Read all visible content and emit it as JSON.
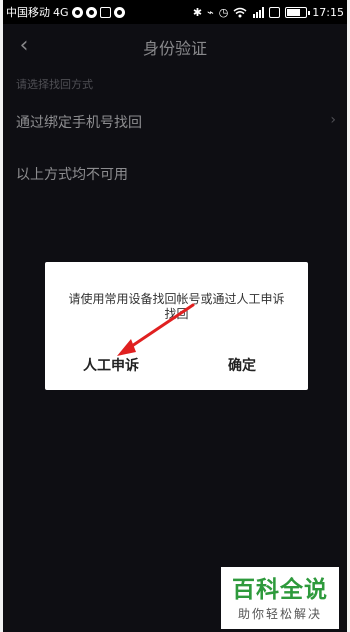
{
  "status_bar": {
    "carrier": "中国移动",
    "network": "4G",
    "time": "17:15",
    "battery_level": 0.75,
    "icons": [
      "circle-s-icon",
      "circle-s-icon",
      "image-icon",
      "cloud-icon",
      "bluetooth-icon",
      "vibrate-icon",
      "alarm-icon",
      "wifi-icon",
      "signal-icon",
      "sim-icon",
      "battery-icon"
    ]
  },
  "header": {
    "back_icon": "‹",
    "title": "身份验证"
  },
  "section_hint": "请选择找回方式",
  "options": [
    {
      "label": "通过绑定手机号找回",
      "has_chevron": true
    },
    {
      "label": "以上方式均不可用",
      "has_chevron": false
    }
  ],
  "chevron_glyph": "›",
  "dialog": {
    "message": "请使用常用设备找回帐号或通过人工申诉找回",
    "appeal_button": "人工申诉",
    "confirm_button": "确定"
  },
  "annotation": {
    "color": "#e02020",
    "icon": "red-arrow"
  },
  "watermark": {
    "title": "百科全说",
    "subtitle": "助你轻松解决",
    "color": "#2e9a3c"
  }
}
